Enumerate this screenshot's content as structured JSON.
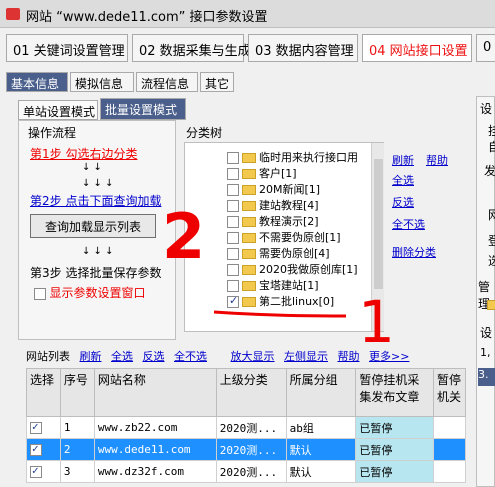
{
  "window": {
    "title": "网站 “www.dede11.com” 接口参数设置"
  },
  "main_tabs": [
    "01 关键词设置管理",
    "02 数据采集与生成",
    "03 数据内容管理",
    "04 网站接口设置",
    "0"
  ],
  "sub_tabs": [
    "基本信息",
    "模拟信息",
    "流程信息",
    "其它"
  ],
  "mode_tabs": [
    "单站设置模式",
    "批量设置模式"
  ],
  "workflow": {
    "title": "操作流程",
    "step1": "第1步 勾选右边分类",
    "step2": "第2步 点击下面查询加载",
    "query_button": "查询加载显示列表",
    "step3": "第3步 选择批量保存参数",
    "show_params": "显示参数设置窗口"
  },
  "category": {
    "title": "分类树",
    "items": [
      {
        "label": "临时用来执行接口用",
        "checked": false
      },
      {
        "label": "客户[1]",
        "checked": false
      },
      {
        "label": "20M新闻[1]",
        "checked": false
      },
      {
        "label": "建站教程[4]",
        "checked": false
      },
      {
        "label": "教程演示[2]",
        "checked": false
      },
      {
        "label": "不需要伪原创[1]",
        "checked": false
      },
      {
        "label": "需要伪原创[4]",
        "checked": false
      },
      {
        "label": "2020我做原创库[1]",
        "checked": false
      },
      {
        "label": "宝塔建站[1]",
        "checked": false
      },
      {
        "label": "第二批linux[0]",
        "checked": true
      }
    ],
    "actions": {
      "refresh": "刷新",
      "help": "帮助",
      "select_all": "全选",
      "invert": "反选",
      "select_none": "全不选",
      "delete": "删除分类"
    }
  },
  "site_list": {
    "title": "网站列表",
    "refresh": "刷新",
    "select_all": "全选",
    "invert": "反选",
    "select_none": "全不选",
    "zoom_in": "放大显示",
    "restore": "左侧显示",
    "help": "帮助",
    "more": "更多>>",
    "columns": [
      "选择",
      "序号",
      "网站名称",
      "上级分类",
      "所属分组",
      "暂停挂机采集发布文章",
      "暂停机关"
    ],
    "rows": [
      {
        "checked": true,
        "no": "1",
        "name": "www.zb22.com",
        "parent": "2020测...",
        "group": "ab组",
        "status": "已暂停",
        "selected": false
      },
      {
        "checked": true,
        "no": "2",
        "name": "www.dede11.com",
        "parent": "2020测...",
        "group": "默认",
        "status": "已暂停",
        "selected": true
      },
      {
        "checked": true,
        "no": "3",
        "name": "www.dz32f.com",
        "parent": "2020测...",
        "group": "默认",
        "status": "已暂停",
        "selected": false
      }
    ]
  },
  "right_panel": {
    "t1": "设",
    "t2": "挂",
    "t3": "自",
    "t4": "发",
    "t5": "网",
    "t6": "登",
    "t7": "选",
    "manage": "管理",
    "t8": "设",
    "t9": "1,",
    "t10": "3."
  },
  "annotation": {
    "num2": "2",
    "num1": "1"
  }
}
